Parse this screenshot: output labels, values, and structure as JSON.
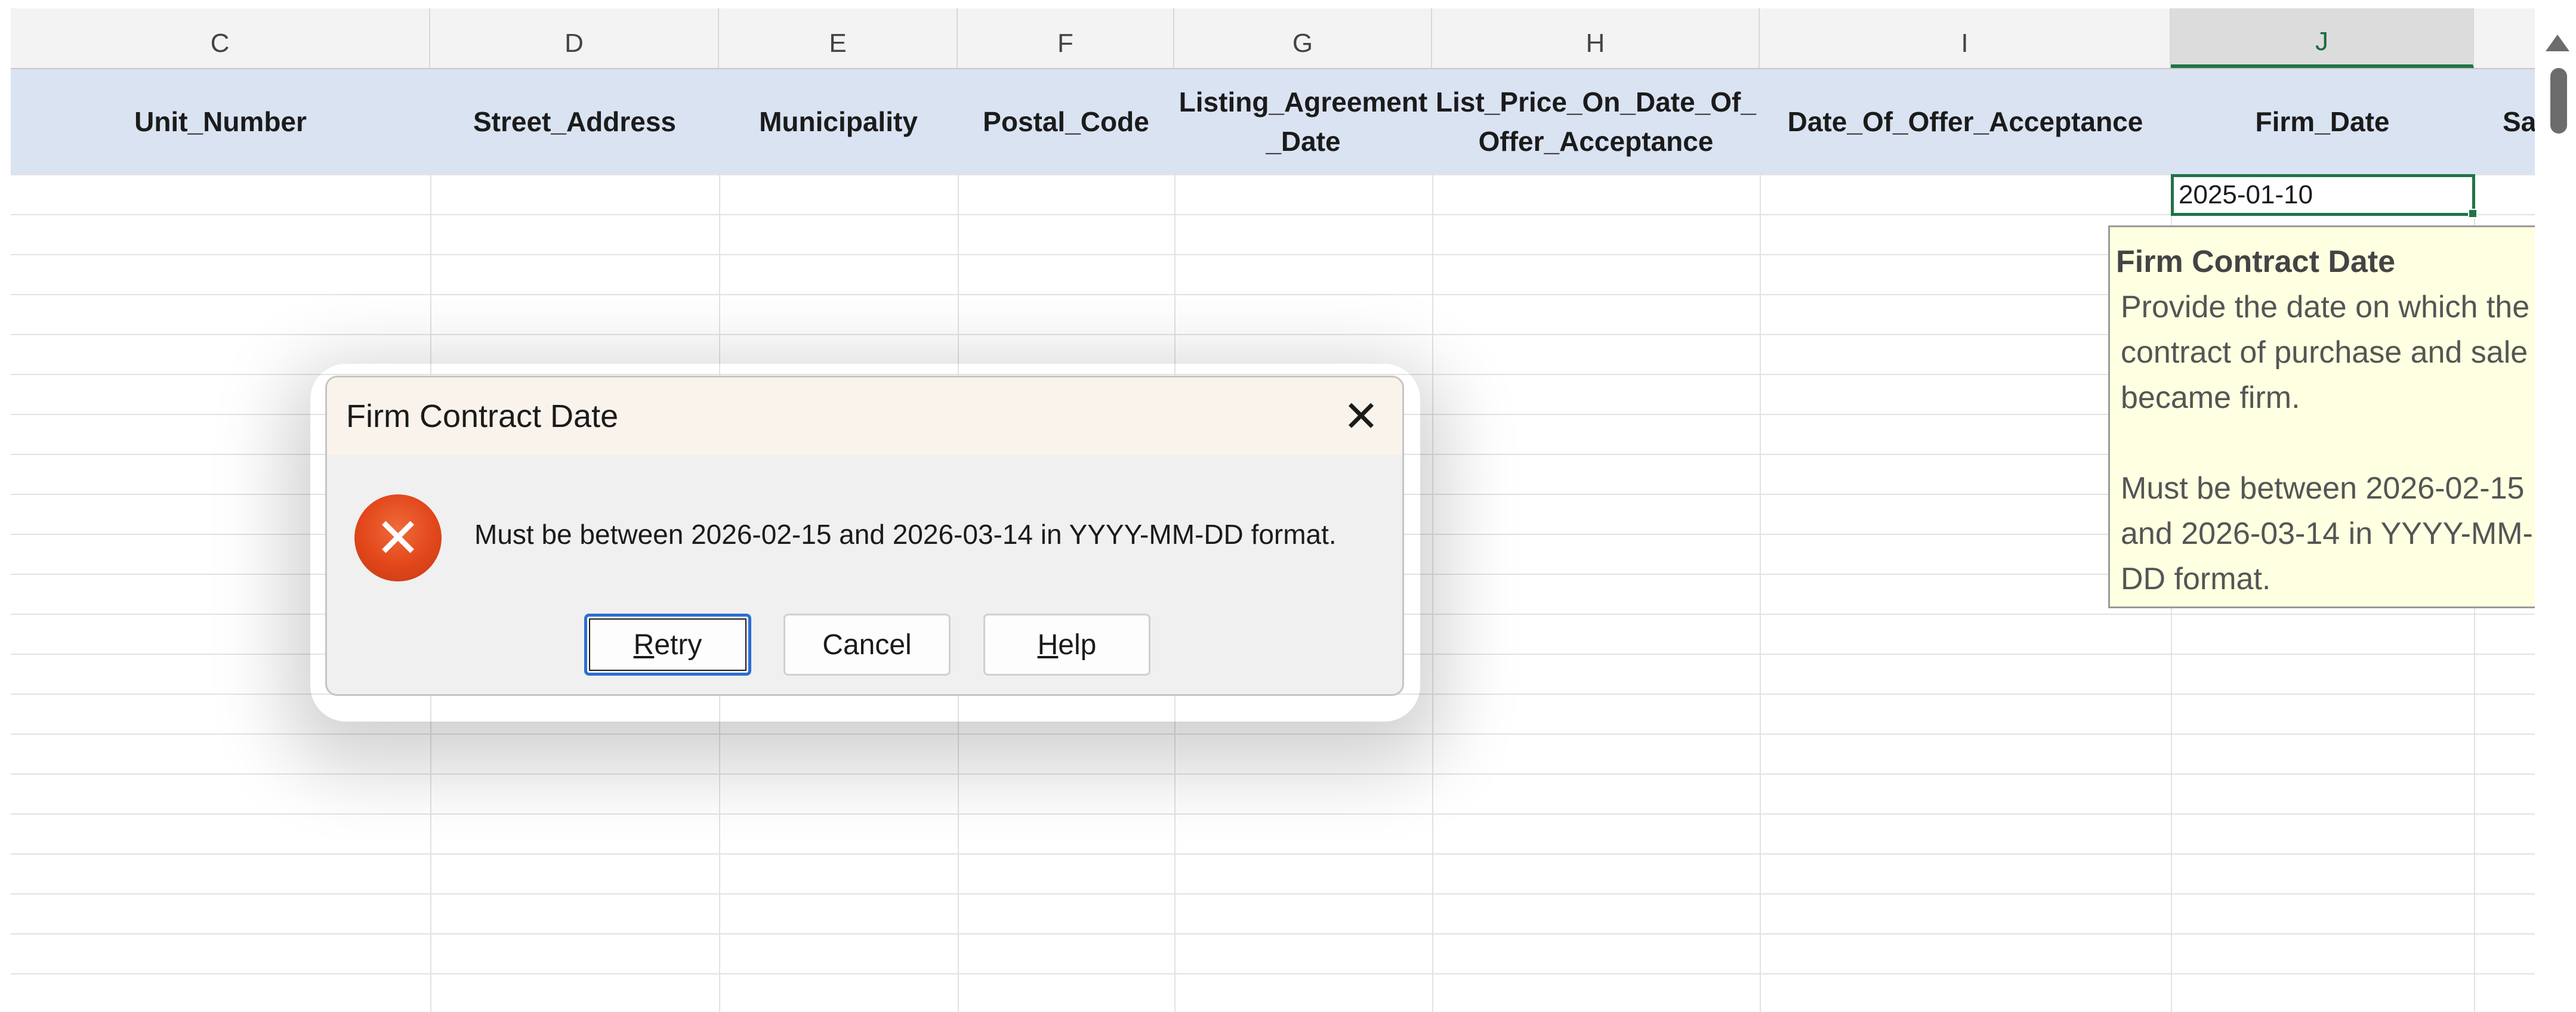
{
  "columns": [
    {
      "letter": "C",
      "field": "Unit_Number"
    },
    {
      "letter": "D",
      "field": "Street_Address"
    },
    {
      "letter": "E",
      "field": "Municipality"
    },
    {
      "letter": "F",
      "field": "Postal_Code"
    },
    {
      "letter": "G",
      "field": "Listing_Agreement\n_Date"
    },
    {
      "letter": "H",
      "field": "List_Price_On_Date_Of_\nOffer_Acceptance"
    },
    {
      "letter": "I",
      "field": "Date_Of_Offer_Acceptance"
    },
    {
      "letter": "J",
      "field": "Firm_Date"
    },
    {
      "letter": "",
      "field": "Sal"
    }
  ],
  "active_cell": {
    "column": "J",
    "value": "2025-01-10"
  },
  "input_message": {
    "title": "Firm Contract Date",
    "body": "Provide the date on which the contract of purchase and sale became firm.",
    "rule": "Must be between 2026-02-15 and 2026-03-14 in YYYY-MM-DD format."
  },
  "dialog": {
    "title": "Firm Contract Date",
    "close_glyph": "✕",
    "icon": "error-icon",
    "icon_glyph": "✕",
    "message": "Must be between 2026-02-15 and 2026-03-14 in YYYY-MM-DD format.",
    "buttons": {
      "retry": {
        "accel": "R",
        "rest": "etry"
      },
      "cancel": "Cancel",
      "help": {
        "accel": "H",
        "rest": "elp"
      }
    }
  },
  "colors": {
    "accent_green": "#217346",
    "header_fill": "#dae3f2",
    "tooltip_fill": "#ffffe1",
    "error_red": "#e2461a"
  }
}
